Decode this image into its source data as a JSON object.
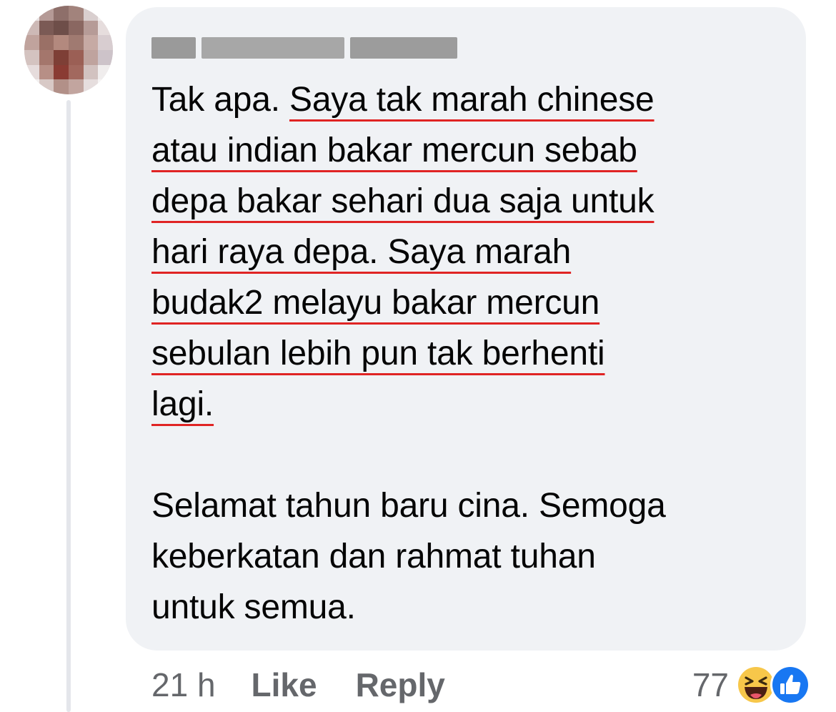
{
  "author": {
    "name": ""
  },
  "comment": {
    "intro": "Tak apa.",
    "lines": [
      "Saya tak marah chinese",
      "atau indian bakar mercun sebab",
      "depa bakar sehari dua saja untuk",
      "hari raya depa. Saya marah",
      "budak2 melayu bakar mercun",
      "sebulan lebih pun tak berhenti",
      "lagi."
    ],
    "second_paragraph": [
      "Selamat tahun baru cina. Semoga",
      "keberkatan dan rahmat tuhan",
      "untuk semua."
    ]
  },
  "meta": {
    "time": "21 h",
    "like_label": "Like",
    "reply_label": "Reply"
  },
  "reactions": {
    "count": "77",
    "icons": [
      "haha-icon",
      "like-icon"
    ]
  },
  "colors": {
    "bubble": "#f0f2f5",
    "underline": "#e02424",
    "meta_text": "#65676b",
    "like_blue": "#1877f2",
    "haha_yellow": "#f7c74a"
  }
}
